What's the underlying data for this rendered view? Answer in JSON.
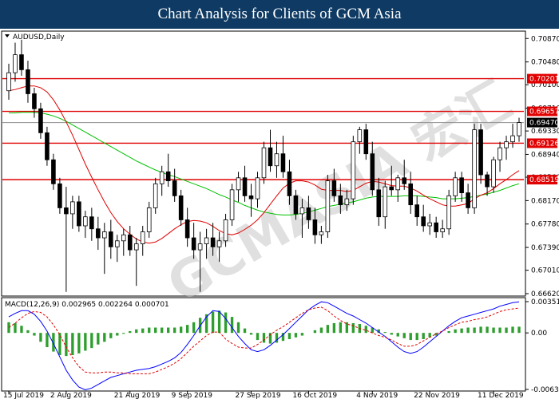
{
  "header": {
    "title": "Chart Analysis for Clients of GCM Asia"
  },
  "chart_data": {
    "type": "candlestick",
    "symbol_label": "AUDUSD,Daily",
    "watermark": "GCMASIA 宏汇",
    "ylim": [
      0.6662,
      0.709
    ],
    "y_ticks": [
      "0.70870",
      "0.70480",
      "0.70100",
      "0.69710",
      "0.69330",
      "0.68940",
      "0.68560",
      "0.68170",
      "0.67780",
      "0.67390",
      "0.67010",
      "0.66620"
    ],
    "x_tick_labels": [
      "15 Jul 2019",
      "2 Aug 2019",
      "21 Aug 2019",
      "9 Sep 2019",
      "27 Sep 2019",
      "16 Oct 2019",
      "4 Nov 2019",
      "22 Nov 2019",
      "11 Dec 2019"
    ],
    "levels": [
      {
        "value": 0.70201,
        "label": "0.70201",
        "color": "#e00000"
      },
      {
        "value": 0.69657,
        "label": "0.69657",
        "color": "#e00000"
      },
      {
        "value": 0.69126,
        "label": "0.69126",
        "color": "#e00000"
      },
      {
        "value": 0.68519,
        "label": "0.68519",
        "color": "#e00000"
      }
    ],
    "current_price": {
      "value": 0.6947,
      "label": "0.69470"
    },
    "price_series": [
      [
        0.7,
        0.7045,
        0.6985,
        0.703
      ],
      [
        0.703,
        0.708,
        0.7015,
        0.706
      ],
      [
        0.706,
        0.7085,
        0.7025,
        0.7035
      ],
      [
        0.7035,
        0.705,
        0.698,
        0.6995
      ],
      [
        0.6995,
        0.7005,
        0.6955,
        0.697
      ],
      [
        0.697,
        0.698,
        0.692,
        0.693
      ],
      [
        0.693,
        0.694,
        0.6875,
        0.6885
      ],
      [
        0.6885,
        0.6895,
        0.6835,
        0.6845
      ],
      [
        0.6845,
        0.6855,
        0.6795,
        0.6805
      ],
      [
        0.6805,
        0.684,
        0.6665,
        0.6795
      ],
      [
        0.6795,
        0.6825,
        0.677,
        0.6815
      ],
      [
        0.6815,
        0.6825,
        0.6765,
        0.6775
      ],
      [
        0.6775,
        0.68,
        0.6755,
        0.679
      ],
      [
        0.679,
        0.6805,
        0.675,
        0.677
      ],
      [
        0.677,
        0.679,
        0.6735,
        0.6755
      ],
      [
        0.6755,
        0.678,
        0.6695,
        0.6765
      ],
      [
        0.6765,
        0.6785,
        0.672,
        0.674
      ],
      [
        0.674,
        0.676,
        0.6715,
        0.675
      ],
      [
        0.675,
        0.677,
        0.6725,
        0.676
      ],
      [
        0.676,
        0.6775,
        0.6725,
        0.6735
      ],
      [
        0.6735,
        0.6755,
        0.6675,
        0.6745
      ],
      [
        0.6745,
        0.6775,
        0.6725,
        0.6765
      ],
      [
        0.6765,
        0.6815,
        0.6755,
        0.6805
      ],
      [
        0.6805,
        0.6855,
        0.6795,
        0.6845
      ],
      [
        0.6845,
        0.6875,
        0.6825,
        0.6865
      ],
      [
        0.6865,
        0.6895,
        0.684,
        0.685
      ],
      [
        0.685,
        0.687,
        0.6815,
        0.6825
      ],
      [
        0.6825,
        0.6835,
        0.6775,
        0.6785
      ],
      [
        0.6785,
        0.6805,
        0.674,
        0.6755
      ],
      [
        0.6755,
        0.678,
        0.672,
        0.6735
      ],
      [
        0.6735,
        0.6765,
        0.6665,
        0.6745
      ],
      [
        0.6745,
        0.677,
        0.672,
        0.6755
      ],
      [
        0.6755,
        0.678,
        0.6725,
        0.674
      ],
      [
        0.674,
        0.6765,
        0.6715,
        0.675
      ],
      [
        0.675,
        0.6795,
        0.674,
        0.6785
      ],
      [
        0.6785,
        0.6845,
        0.6775,
        0.6835
      ],
      [
        0.6835,
        0.6865,
        0.6815,
        0.6855
      ],
      [
        0.6855,
        0.6875,
        0.6815,
        0.6825
      ],
      [
        0.6825,
        0.6845,
        0.679,
        0.682
      ],
      [
        0.682,
        0.6865,
        0.6805,
        0.6855
      ],
      [
        0.6855,
        0.6915,
        0.6845,
        0.6905
      ],
      [
        0.6905,
        0.6935,
        0.6865,
        0.6875
      ],
      [
        0.6875,
        0.6915,
        0.6855,
        0.6895
      ],
      [
        0.6895,
        0.6925,
        0.6855,
        0.6865
      ],
      [
        0.6865,
        0.6885,
        0.681,
        0.6825
      ],
      [
        0.6825,
        0.6835,
        0.6785,
        0.6795
      ],
      [
        0.6795,
        0.682,
        0.6755,
        0.6805
      ],
      [
        0.6805,
        0.6825,
        0.677,
        0.6785
      ],
      [
        0.6785,
        0.6805,
        0.6745,
        0.676
      ],
      [
        0.676,
        0.6775,
        0.6745,
        0.6765
      ],
      [
        0.6765,
        0.686,
        0.6755,
        0.685
      ],
      [
        0.685,
        0.687,
        0.6815,
        0.6825
      ],
      [
        0.6825,
        0.6845,
        0.6795,
        0.681
      ],
      [
        0.681,
        0.6835,
        0.68,
        0.682
      ],
      [
        0.682,
        0.6925,
        0.681,
        0.6915
      ],
      [
        0.6915,
        0.694,
        0.6895,
        0.6935
      ],
      [
        0.6935,
        0.6945,
        0.6885,
        0.6895
      ],
      [
        0.6895,
        0.6915,
        0.6825,
        0.6835
      ],
      [
        0.6835,
        0.6855,
        0.6775,
        0.679
      ],
      [
        0.679,
        0.685,
        0.677,
        0.684
      ],
      [
        0.684,
        0.6875,
        0.6825,
        0.6835
      ],
      [
        0.6835,
        0.686,
        0.6815,
        0.6855
      ],
      [
        0.6855,
        0.6885,
        0.6835,
        0.6845
      ],
      [
        0.6845,
        0.6865,
        0.6795,
        0.681
      ],
      [
        0.681,
        0.6825,
        0.6775,
        0.679
      ],
      [
        0.679,
        0.681,
        0.6765,
        0.6775
      ],
      [
        0.6775,
        0.6795,
        0.676,
        0.678
      ],
      [
        0.678,
        0.679,
        0.6755,
        0.6765
      ],
      [
        0.6765,
        0.6785,
        0.6755,
        0.677
      ],
      [
        0.677,
        0.6835,
        0.676,
        0.6825
      ],
      [
        0.6825,
        0.6865,
        0.6815,
        0.6855
      ],
      [
        0.6855,
        0.6865,
        0.6815,
        0.683
      ],
      [
        0.683,
        0.6845,
        0.6795,
        0.6805
      ],
      [
        0.6805,
        0.6945,
        0.6795,
        0.6935
      ],
      [
        0.6935,
        0.6945,
        0.6845,
        0.686
      ],
      [
        0.686,
        0.6865,
        0.6825,
        0.684
      ],
      [
        0.684,
        0.689,
        0.683,
        0.6885
      ],
      [
        0.6885,
        0.6915,
        0.6865,
        0.6905
      ],
      [
        0.6905,
        0.6925,
        0.6885,
        0.6915
      ],
      [
        0.6915,
        0.6945,
        0.6905,
        0.6925
      ],
      [
        0.6925,
        0.6955,
        0.6915,
        0.6947
      ]
    ],
    "ma_red": [
      0.7,
      0.7002,
      0.7005,
      0.7008,
      0.7008,
      0.7005,
      0.6998,
      0.6985,
      0.6968,
      0.6948,
      0.6926,
      0.6902,
      0.6878,
      0.6856,
      0.6835,
      0.6815,
      0.6797,
      0.6782,
      0.677,
      0.6761,
      0.6753,
      0.6748,
      0.6746,
      0.6748,
      0.6754,
      0.6762,
      0.677,
      0.6777,
      0.6782,
      0.6784,
      0.6783,
      0.678,
      0.6774,
      0.6767,
      0.6762,
      0.676,
      0.6763,
      0.6769,
      0.6776,
      0.6785,
      0.6797,
      0.6811,
      0.6825,
      0.6838,
      0.6846,
      0.685,
      0.685,
      0.6848,
      0.6843,
      0.6836,
      0.6834,
      0.6834,
      0.6834,
      0.6832,
      0.6834,
      0.684,
      0.6846,
      0.6849,
      0.6848,
      0.6845,
      0.6842,
      0.6841,
      0.6841,
      0.6838,
      0.6833,
      0.6826,
      0.682,
      0.6815,
      0.681,
      0.6808,
      0.6808,
      0.681,
      0.6812,
      0.682,
      0.6826,
      0.683,
      0.6837,
      0.6845,
      0.6852,
      0.686,
      0.6867
    ],
    "ma_green": [
      0.6963,
      0.6963,
      0.6964,
      0.6964,
      0.6964,
      0.6963,
      0.6961,
      0.6958,
      0.6954,
      0.6949,
      0.6943,
      0.6937,
      0.6931,
      0.6925,
      0.6919,
      0.6913,
      0.6907,
      0.6901,
      0.6895,
      0.6889,
      0.6883,
      0.6878,
      0.6873,
      0.6868,
      0.6864,
      0.686,
      0.6857,
      0.6853,
      0.6849,
      0.6845,
      0.6841,
      0.6837,
      0.6832,
      0.6827,
      0.6823,
      0.6818,
      0.6814,
      0.6809,
      0.6805,
      0.6801,
      0.6798,
      0.6796,
      0.6794,
      0.6793,
      0.6793,
      0.6794,
      0.6796,
      0.6798,
      0.6801,
      0.6804,
      0.6807,
      0.6809,
      0.6811,
      0.6813,
      0.6815,
      0.6818,
      0.6821,
      0.6823,
      0.6824,
      0.6824,
      0.6824,
      0.6824,
      0.6825,
      0.6825,
      0.6825,
      0.6824,
      0.6823,
      0.6822,
      0.682,
      0.682,
      0.682,
      0.6821,
      0.6822,
      0.6824,
      0.6826,
      0.6828,
      0.6831,
      0.6834,
      0.6838,
      0.6842,
      0.6845
    ],
    "macd_label": "MACD(12,26,9) 0.002965 0.002264 0.000701",
    "macd_ylim": [
      -0.006356,
      0.003516
    ],
    "macd_ticks": [
      "0.003516",
      "0.00",
      "-0.006356"
    ],
    "macd_hist": [
      0.0012,
      0.0011,
      0.0008,
      0.0003,
      -0.0003,
      -0.001,
      -0.0016,
      -0.0021,
      -0.0025,
      -0.0026,
      -0.0025,
      -0.0023,
      -0.002,
      -0.0017,
      -0.0013,
      -0.001,
      -0.0006,
      -0.0003,
      -0.0001,
      0.0002,
      0.0004,
      0.0005,
      0.0006,
      0.0006,
      0.0006,
      0.0006,
      0.0006,
      0.0007,
      0.0009,
      0.0012,
      0.0017,
      0.0021,
      0.0024,
      0.0025,
      0.0023,
      0.0018,
      0.0012,
      0.0005,
      -0.0002,
      -0.0008,
      -0.0011,
      -0.0012,
      -0.0011,
      -0.0009,
      -0.0007,
      -0.0005,
      -0.0003,
      0.0,
      0.0003,
      0.0006,
      0.0009,
      0.0011,
      0.0012,
      0.0012,
      0.0011,
      0.001,
      0.0008,
      0.0006,
      0.0004,
      0.0001,
      -0.0002,
      -0.0004,
      -0.0006,
      -0.0008,
      -0.0008,
      -0.0007,
      -0.0005,
      -0.0003,
      0.0,
      0.0002,
      0.0004,
      0.0005,
      0.0006,
      0.0006,
      0.0007,
      0.0007,
      0.0006,
      0.0006,
      0.0006,
      0.0007,
      0.0007
    ],
    "macd_line": [
      0.0018,
      0.0022,
      0.0025,
      0.0025,
      0.0021,
      0.0013,
      0.0002,
      -0.0012,
      -0.0027,
      -0.0042,
      -0.0053,
      -0.0061,
      -0.0064,
      -0.0062,
      -0.0058,
      -0.0054,
      -0.005,
      -0.0048,
      -0.0046,
      -0.0044,
      -0.0042,
      -0.0041,
      -0.004,
      -0.0038,
      -0.0035,
      -0.0032,
      -0.0028,
      -0.0022,
      -0.0013,
      -0.0003,
      0.0008,
      0.0018,
      0.0025,
      0.0024,
      0.0016,
      0.0006,
      -0.0004,
      -0.0012,
      -0.0019,
      -0.0021,
      -0.0019,
      -0.0014,
      -0.0008,
      -0.0002,
      0.0005,
      0.0012,
      0.0019,
      0.0026,
      0.0031,
      0.0035,
      0.0034,
      0.003,
      0.0026,
      0.0022,
      0.0019,
      0.0015,
      0.0011,
      0.0006,
      0.0001,
      -0.0004,
      -0.001,
      -0.0016,
      -0.0021,
      -0.0023,
      -0.0021,
      -0.0016,
      -0.001,
      -0.0004,
      0.0002,
      0.0008,
      0.0013,
      0.0017,
      0.0019,
      0.0021,
      0.0023,
      0.0025,
      0.0027,
      0.003,
      0.0032,
      0.0034,
      0.0035
    ],
    "macd_signal": [
      0.0006,
      0.0011,
      0.0017,
      0.0022,
      0.0024,
      0.0023,
      0.0018,
      0.0009,
      -0.0002,
      -0.0016,
      -0.0028,
      -0.0038,
      -0.0044,
      -0.0045,
      -0.0045,
      -0.0044,
      -0.0044,
      -0.0045,
      -0.0045,
      -0.0046,
      -0.0046,
      -0.0046,
      -0.0046,
      -0.0044,
      -0.0041,
      -0.0038,
      -0.0034,
      -0.0029,
      -0.0022,
      -0.0015,
      -0.0009,
      -0.0003,
      0.0001,
      0.0001,
      -0.0007,
      -0.0012,
      -0.0016,
      -0.0017,
      -0.0017,
      -0.0013,
      -0.0008,
      -0.0002,
      0.0003,
      0.0007,
      0.0012,
      0.0017,
      0.0022,
      0.0026,
      0.0028,
      0.0029,
      0.0025,
      0.0019,
      0.0014,
      0.001,
      0.0008,
      0.0005,
      0.0003,
      0.0,
      -0.0003,
      -0.0005,
      -0.0008,
      -0.0012,
      -0.0015,
      -0.0015,
      -0.0013,
      -0.0009,
      -0.0005,
      -0.0001,
      0.0002,
      0.0006,
      0.0009,
      0.0012,
      0.0013,
      0.0015,
      0.0016,
      0.0018,
      0.0021,
      0.0024,
      0.0026,
      0.0027,
      0.0028
    ]
  },
  "colors": {
    "header_bg": "#0e3a63",
    "candle": "#000000",
    "ma_red": "#e00000",
    "ma_green": "#00c000",
    "level_line": "#e00000",
    "macd_line": "#0000ff",
    "macd_signal": "#e00000",
    "macd_hist": "#2e9e2e"
  }
}
